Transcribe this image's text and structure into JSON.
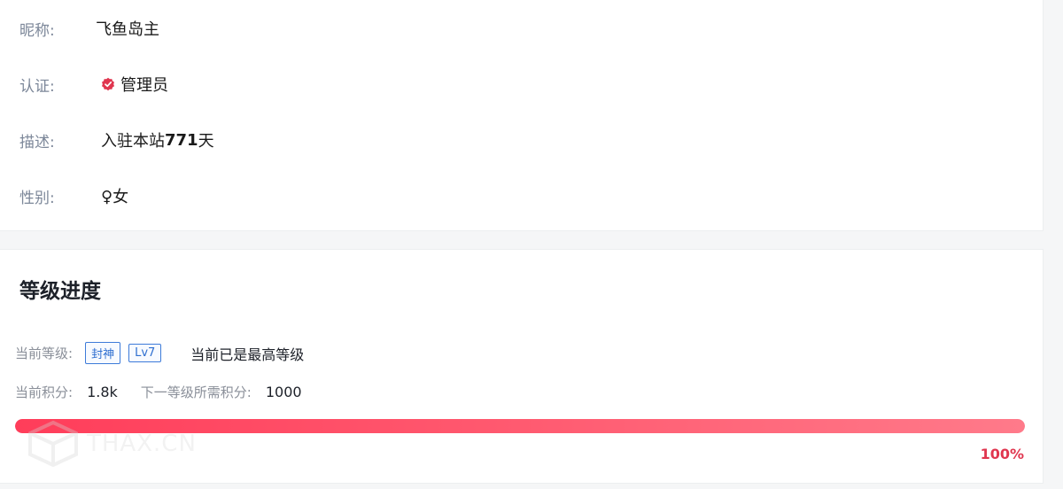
{
  "profile": {
    "nickname_label": "昵称:",
    "nickname_value": "飞鱼岛主",
    "cert_label": "认证:",
    "cert_value": "管理员",
    "desc_label": "描述:",
    "desc_prefix": "入驻本站",
    "desc_days": "771",
    "desc_suffix": "天",
    "gender_label": "性别:",
    "gender_value": "♀女"
  },
  "level": {
    "title": "等级进度",
    "current_level_label": "当前等级:",
    "level_tag": "封神",
    "level_lv": "Lv7",
    "level_status": "当前已是最高等级",
    "points_label": "当前积分:",
    "points_value": "1.8k",
    "next_label": "下一等级所需积分:",
    "next_value": "1000",
    "progress_percent_text": "100%",
    "progress_fraction": 1.0
  },
  "watermark_text": "THAX.CN",
  "colors": {
    "accent_red": "#e0364f",
    "tag_blue": "#2f6fd0"
  }
}
